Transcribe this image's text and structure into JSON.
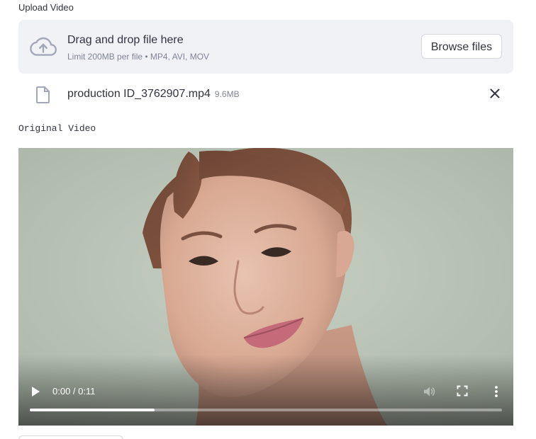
{
  "uploader": {
    "label": "Upload Video",
    "dropzone_title": "Drag and drop file here",
    "dropzone_limit": "Limit 200MB per file • MP4, AVI, MOV",
    "browse_label": "Browse files",
    "cloud_icon": "cloud-upload-icon"
  },
  "uploaded_file": {
    "name": "production ID_3762907.mp4",
    "size": "9.6MB",
    "file_icon": "file-icon",
    "remove_icon": "close-icon"
  },
  "original_section": {
    "label": "Original Video"
  },
  "player": {
    "time": "0:00 / 0:11",
    "progress": 0.265,
    "play_icon": "play-icon",
    "volume_icon": "volume-icon",
    "fullscreen_icon": "fullscreen-icon",
    "more_icon": "more-vert-icon"
  },
  "colors": {
    "dropzone_bg": "#f0f2f6",
    "icon_gray": "#a3a8b8",
    "text": "#31333f",
    "muted": "#808495"
  }
}
